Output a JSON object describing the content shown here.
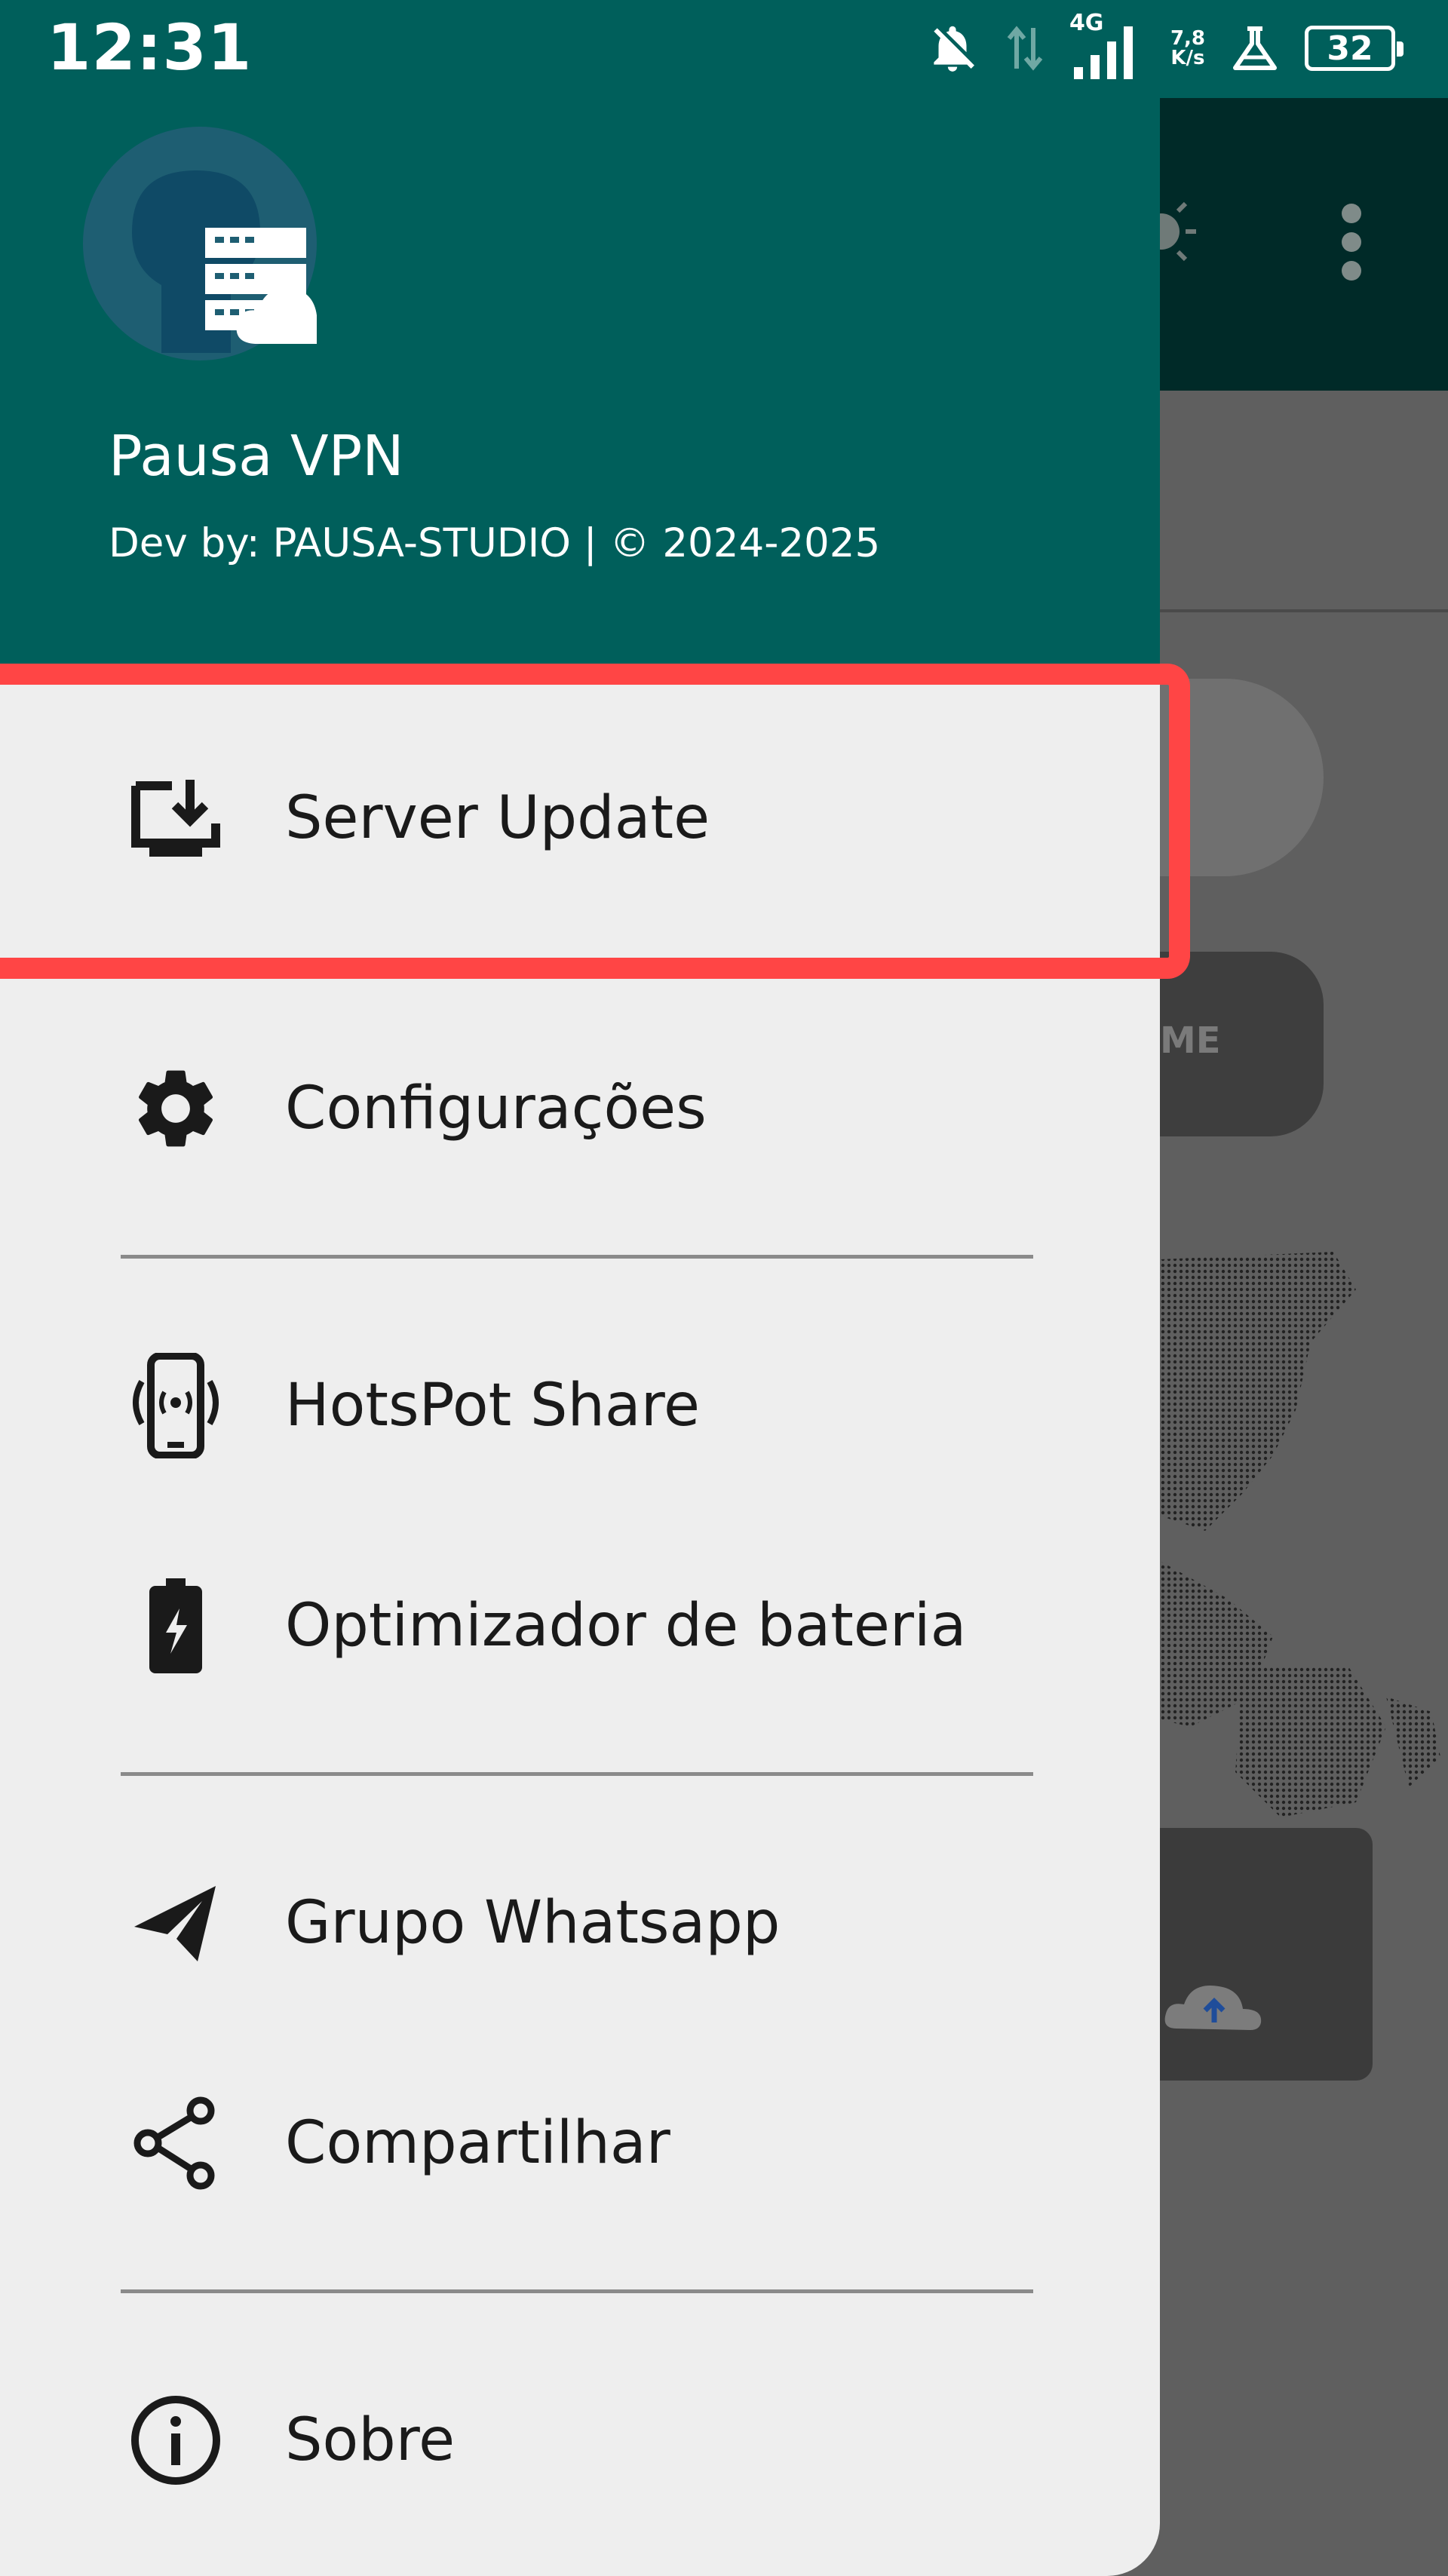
{
  "status_bar": {
    "time": "12:31",
    "network_type": "4G",
    "speed_value": "7,8",
    "speed_unit": "K/s",
    "battery": "32",
    "icons": [
      "bell-off-icon",
      "data-arrows-icon",
      "signal-icon",
      "alert-flask-icon",
      "battery-icon"
    ]
  },
  "drawer": {
    "app_name": "Pausa VPN",
    "developer": "Dev by: PAUSA-STUDIO | © 2024-2025",
    "items": [
      {
        "label": "Server Update",
        "icon": "server-download-icon"
      },
      {
        "label": "Configurações",
        "icon": "gear-icon"
      },
      {
        "label": "HotsPot Share",
        "icon": "hotspot-phone-icon"
      },
      {
        "label": "Optimizador de bateria",
        "icon": "battery-bolt-icon"
      },
      {
        "label": "Grupo Whatsapp",
        "icon": "send-icon"
      },
      {
        "label": "Compartilhar",
        "icon": "share-icon"
      },
      {
        "label": "Sobre",
        "icon": "info-icon"
      }
    ]
  },
  "background": {
    "button_fragment": "ME"
  },
  "colors": {
    "header": "#005f5b",
    "drawer_bg": "#eeeeee",
    "highlight": "#ff4545",
    "scrim": "#5f5f5f"
  }
}
